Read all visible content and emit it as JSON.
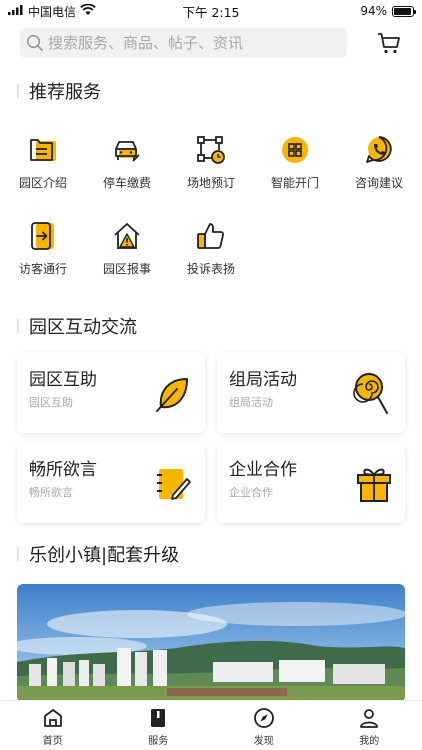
{
  "status": {
    "carrier": "中国电信",
    "time": "下午 2:15",
    "battery": "94%",
    "battery_level": 0.94
  },
  "search": {
    "placeholder": "搜索服务、商品、帖子、资讯"
  },
  "sections": {
    "recommend": "推荐服务",
    "interaction": "园区互动交流",
    "upgrade": "乐创小镇|配套升级"
  },
  "services": [
    {
      "label": "园区介绍",
      "icon": "park-intro-icon"
    },
    {
      "label": "停车缴费",
      "icon": "car-payment-icon"
    },
    {
      "label": "场地预订",
      "icon": "venue-booking-icon"
    },
    {
      "label": "智能开门",
      "icon": "smart-door-icon"
    },
    {
      "label": "咨询建议",
      "icon": "consult-phone-icon"
    },
    {
      "label": "访客通行",
      "icon": "visitor-pass-icon"
    },
    {
      "label": "园区报事",
      "icon": "report-issue-icon"
    },
    {
      "label": "投诉表扬",
      "icon": "thumbs-up-icon"
    }
  ],
  "cards": [
    {
      "title": "园区互助",
      "subtitle": "园区互助",
      "icon": "leaf-icon"
    },
    {
      "title": "组局活动",
      "subtitle": "组局活动",
      "icon": "lollipop-icon"
    },
    {
      "title": "畅所欲言",
      "subtitle": "畅所欲言",
      "icon": "notepad-icon"
    },
    {
      "title": "企业合作",
      "subtitle": "企业合作",
      "icon": "gift-icon"
    }
  ],
  "tabs": [
    {
      "label": "首页",
      "icon": "home-icon"
    },
    {
      "label": "服务",
      "icon": "book-icon"
    },
    {
      "label": "发现",
      "icon": "compass-icon"
    },
    {
      "label": "我的",
      "icon": "user-icon"
    }
  ],
  "colors": {
    "accent": "#F7B500",
    "line": "#222222"
  }
}
